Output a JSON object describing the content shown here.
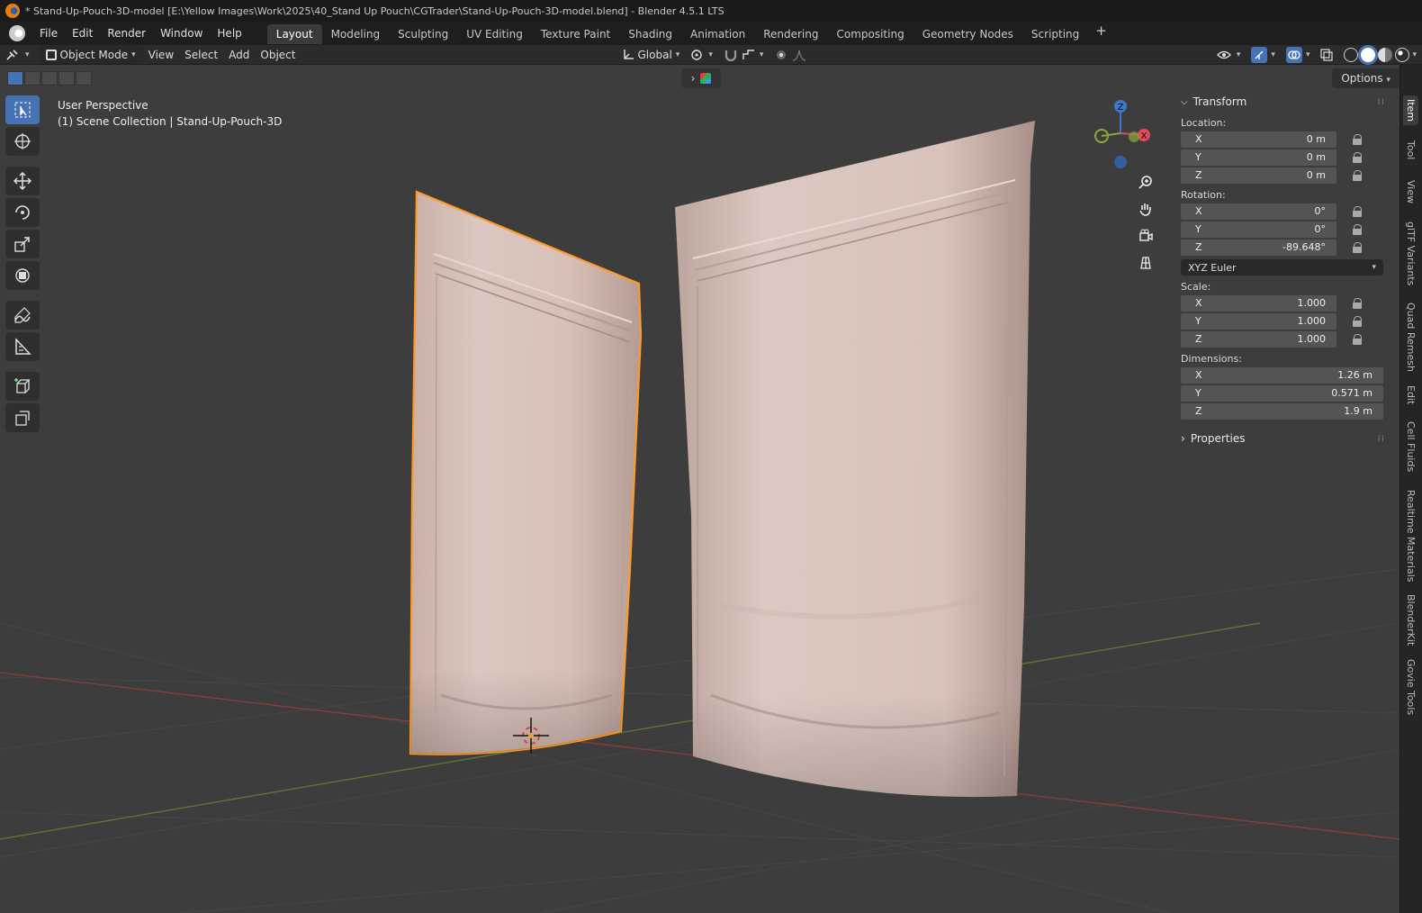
{
  "titlebar": {
    "title": "* Stand-Up-Pouch-3D-model [E:\\Yellow Images\\Work\\2025\\40_Stand Up Pouch\\CGTrader\\Stand-Up-Pouch-3D-model.blend] - Blender 4.5.1 LTS"
  },
  "menubar": {
    "items": [
      "File",
      "Edit",
      "Render",
      "Window",
      "Help"
    ],
    "workspaces": [
      "Layout",
      "Modeling",
      "Sculpting",
      "UV Editing",
      "Texture Paint",
      "Shading",
      "Animation",
      "Rendering",
      "Compositing",
      "Geometry Nodes",
      "Scripting"
    ],
    "active_workspace": "Layout",
    "add_label": "+"
  },
  "header": {
    "mode": "Object Mode",
    "menus": [
      "View",
      "Select",
      "Add",
      "Object"
    ],
    "orientation": "Global"
  },
  "viewport": {
    "perspective": "User Perspective",
    "collection": "(1) Scene Collection | Stand-Up-Pouch-3D",
    "options_label": "Options",
    "colors": {
      "background": "#3d3d3d",
      "selection": "#ff9a2a",
      "pouch": "#d9c3bb",
      "x_axis": "#a84a4a",
      "y_axis": "#7a9a3a"
    }
  },
  "gizmo": {
    "z": "Z",
    "x": "X"
  },
  "npanel": {
    "transform_label": "Transform",
    "location_label": "Location:",
    "location": [
      {
        "axis": "X",
        "value": "0 m"
      },
      {
        "axis": "Y",
        "value": "0 m"
      },
      {
        "axis": "Z",
        "value": "0 m"
      }
    ],
    "rotation_label": "Rotation:",
    "rotation": [
      {
        "axis": "X",
        "value": "0°"
      },
      {
        "axis": "Y",
        "value": "0°"
      },
      {
        "axis": "Z",
        "value": "-89.648°"
      }
    ],
    "rotation_mode": "XYZ Euler",
    "scale_label": "Scale:",
    "scale": [
      {
        "axis": "X",
        "value": "1.000"
      },
      {
        "axis": "Y",
        "value": "1.000"
      },
      {
        "axis": "Z",
        "value": "1.000"
      }
    ],
    "dimensions_label": "Dimensions:",
    "dimensions": [
      {
        "axis": "X",
        "value": "1.26 m"
      },
      {
        "axis": "Y",
        "value": "0.571 m"
      },
      {
        "axis": "Z",
        "value": "1.9 m"
      }
    ],
    "properties_label": "Properties"
  },
  "sidetabs": [
    "Item",
    "Tool",
    "View",
    "glTF Variants",
    "Quad Remesh",
    "Edit",
    "Cell Fluids",
    "Realtime Materials",
    "BlenderKit",
    "Govie Tools"
  ]
}
